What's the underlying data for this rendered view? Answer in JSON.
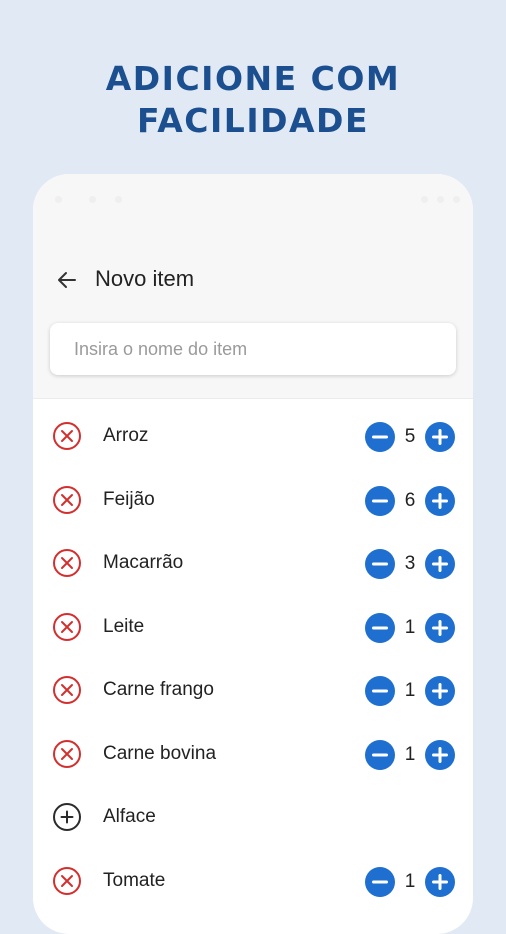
{
  "promo": {
    "title_line1": "ADICIONE COM",
    "title_line2": "FACILIDADE"
  },
  "header": {
    "title": "Novo item",
    "back_icon": "arrow-left-icon"
  },
  "search": {
    "placeholder": "Insira o nome do item",
    "value": ""
  },
  "items": [
    {
      "name": "Arroz",
      "quantity": "5",
      "added": true
    },
    {
      "name": "Feijão",
      "quantity": "6",
      "added": true
    },
    {
      "name": "Macarrão",
      "quantity": "3",
      "added": true
    },
    {
      "name": "Leite",
      "quantity": "1",
      "added": true
    },
    {
      "name": "Carne frango",
      "quantity": "1",
      "added": true
    },
    {
      "name": "Carne bovina",
      "quantity": "1",
      "added": true
    },
    {
      "name": "Alface",
      "quantity": "",
      "added": false
    },
    {
      "name": "Tomate",
      "quantity": "1",
      "added": true
    }
  ],
  "icons": {
    "remove": "close-circle-icon",
    "add_item": "plus-circle-icon",
    "decrement": "minus-circle-icon",
    "increment": "plus-circle-icon"
  },
  "colors": {
    "background": "#e0e9f4",
    "promo_title": "#1b4f8f",
    "remove_red": "#d32f2f",
    "stepper_blue": "#1f6fd1"
  }
}
